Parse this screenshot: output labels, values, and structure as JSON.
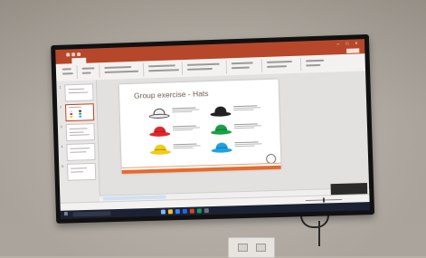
{
  "slide": {
    "title": "Group exercise - Hats"
  },
  "hats": [
    {
      "name": "white-hat",
      "color": "#f2f2f2"
    },
    {
      "name": "black-hat",
      "color": "#222222"
    },
    {
      "name": "red-hat",
      "color": "#e0262a"
    },
    {
      "name": "green-hat",
      "color": "#18a146"
    },
    {
      "name": "yellow-hat",
      "color": "#f2cb15"
    },
    {
      "name": "blue-hat",
      "color": "#1fa3e0"
    }
  ],
  "ribbon_tabs_active": "Home",
  "thumbnail_numbers": [
    "1",
    "2",
    "3",
    "4",
    "5"
  ],
  "colors": {
    "app_accent": "#b7472a",
    "slide_footer": "#e86a2c",
    "taskbar": "#1b2233",
    "notes_hint_bg": "#cfe0f4"
  },
  "icons": [
    "start-icon",
    "search-icon",
    "taskbar-app-icons",
    "window-controls",
    "wifi-icon",
    "volume-icon"
  ]
}
